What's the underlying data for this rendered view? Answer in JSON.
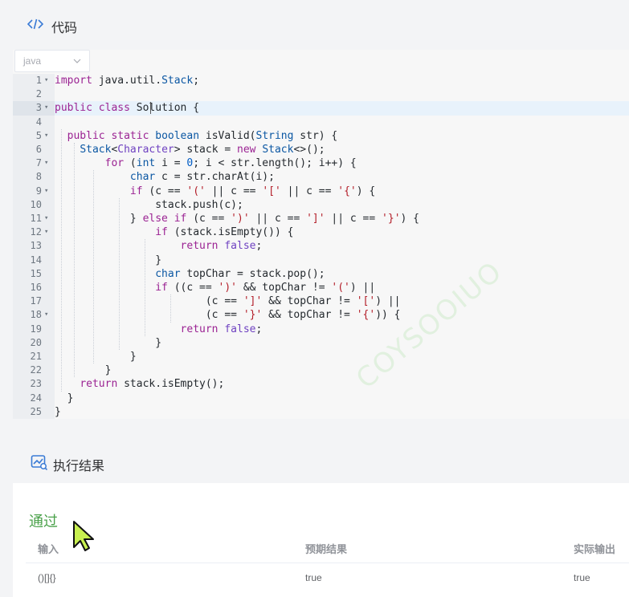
{
  "code_section": {
    "title": "代码",
    "icon": "code-icon",
    "language": "java",
    "lines": [
      {
        "num": "1",
        "fold": true
      },
      {
        "num": "2",
        "fold": false
      },
      {
        "num": "3",
        "fold": true
      },
      {
        "num": "4",
        "fold": false
      },
      {
        "num": "5",
        "fold": true
      },
      {
        "num": "6",
        "fold": false
      },
      {
        "num": "7",
        "fold": true
      },
      {
        "num": "8",
        "fold": false
      },
      {
        "num": "9",
        "fold": true
      },
      {
        "num": "10",
        "fold": false
      },
      {
        "num": "11",
        "fold": true
      },
      {
        "num": "12",
        "fold": true
      },
      {
        "num": "13",
        "fold": false
      },
      {
        "num": "14",
        "fold": false
      },
      {
        "num": "15",
        "fold": false
      },
      {
        "num": "16",
        "fold": false
      },
      {
        "num": "17",
        "fold": false
      },
      {
        "num": "18",
        "fold": true
      },
      {
        "num": "19",
        "fold": false
      },
      {
        "num": "20",
        "fold": false
      },
      {
        "num": "21",
        "fold": false
      },
      {
        "num": "22",
        "fold": false
      },
      {
        "num": "23",
        "fold": false
      },
      {
        "num": "24",
        "fold": false
      },
      {
        "num": "25",
        "fold": false
      }
    ],
    "source": [
      "import java.util.Stack;",
      "",
      "public class Solution {",
      "",
      "  public static boolean isValid(String str) {",
      "    Stack<Character> stack = new Stack<>();",
      "        for (int i = 0; i < str.length(); i++) {",
      "            char c = str.charAt(i);",
      "            if (c == '(' || c == '[' || c == '{') {",
      "                stack.push(c);",
      "            } else if (c == ')' || c == ']' || c == '}') {",
      "                if (stack.isEmpty()) {",
      "                    return false;",
      "                }",
      "                char topChar = stack.pop();",
      "                if ((c == ')' && topChar != '(') ||",
      "                        (c == ']' && topChar != '[') ||",
      "                        (c == '}' && topChar != '{')) {",
      "                    return false;",
      "                }",
      "            }",
      "        }",
      "    return stack.isEmpty();",
      "  }",
      "}"
    ],
    "active_line": 3,
    "watermark": "COYSOOIUO"
  },
  "result_section": {
    "title": "执行结果",
    "icon": "result-chart-icon",
    "status": "通过",
    "status_color": "#4aa14a",
    "columns": [
      "输入",
      "预期结果",
      "实际输出"
    ],
    "rows": [
      {
        "input": "()[]{}",
        "expected": "true",
        "actual": "true"
      }
    ]
  },
  "pointer_icon": "mouse-pointer-icon"
}
